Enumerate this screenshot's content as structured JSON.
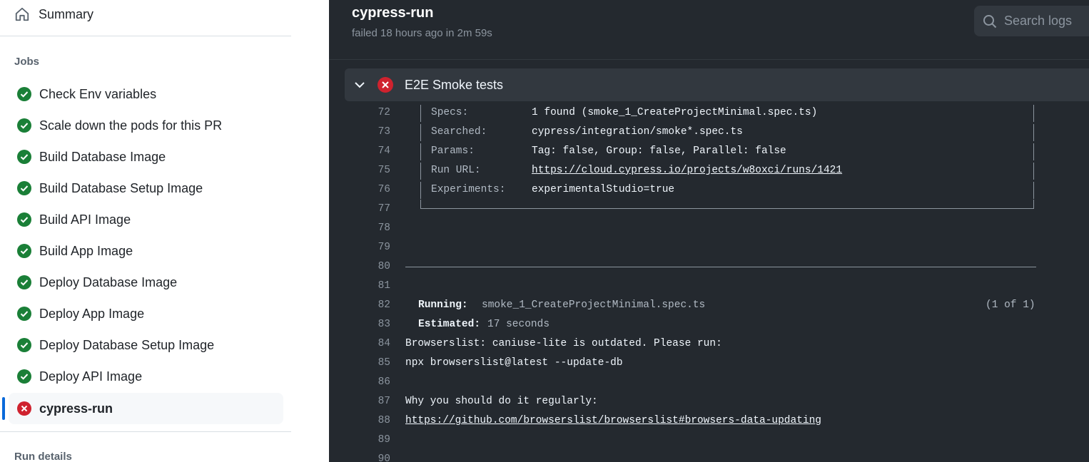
{
  "sidebar": {
    "summary_label": "Summary",
    "jobs_label": "Jobs",
    "run_details_label": "Run details",
    "jobs": [
      {
        "label": "Check Env variables",
        "status": "success"
      },
      {
        "label": "Scale down the pods for this PR",
        "status": "success"
      },
      {
        "label": "Build Database Image",
        "status": "success"
      },
      {
        "label": "Build Database Setup Image",
        "status": "success"
      },
      {
        "label": "Build API Image",
        "status": "success"
      },
      {
        "label": "Build App Image",
        "status": "success"
      },
      {
        "label": "Deploy Database Image",
        "status": "success"
      },
      {
        "label": "Deploy App Image",
        "status": "success"
      },
      {
        "label": "Deploy Database Setup Image",
        "status": "success"
      },
      {
        "label": "Deploy API Image",
        "status": "success"
      },
      {
        "label": "cypress-run",
        "status": "failure",
        "active": true
      }
    ]
  },
  "main": {
    "title": "cypress-run",
    "subtitle": "failed 18 hours ago in 2m 59s",
    "search_placeholder": "Search logs",
    "step": {
      "label": "E2E Smoke tests",
      "status": "failure"
    },
    "log": {
      "l72": {
        "n": "72",
        "key": "Specs:",
        "val": "1 found (smoke_1_CreateProjectMinimal.spec.ts)"
      },
      "l73": {
        "n": "73",
        "key": "Searched:",
        "val": "cypress/integration/smoke*.spec.ts"
      },
      "l74": {
        "n": "74",
        "key": "Params:",
        "val": "Tag: false, Group: false, Parallel: false"
      },
      "l75": {
        "n": "75",
        "key": "Run URL:",
        "val": "https://cloud.cypress.io/projects/w8oxci/runs/1421"
      },
      "l76": {
        "n": "76",
        "key": "Experiments:",
        "val": "experimentalStudio=true"
      },
      "l77": {
        "n": "77"
      },
      "l78": {
        "n": "78"
      },
      "l79": {
        "n": "79"
      },
      "l80": {
        "n": "80"
      },
      "l81": {
        "n": "81"
      },
      "l82": {
        "n": "82",
        "key": "Running:",
        "val": "smoke_1_CreateProjectMinimal.spec.ts",
        "right": "(1 of 1)"
      },
      "l83": {
        "n": "83",
        "key": "Estimated:",
        "val": "17 seconds"
      },
      "l84": {
        "n": "84",
        "text": "Browserslist: caniuse-lite is outdated. Please run:"
      },
      "l85": {
        "n": "85",
        "text": "npx browserslist@latest --update-db"
      },
      "l86": {
        "n": "86"
      },
      "l87": {
        "n": "87",
        "text": "Why you should do it regularly:"
      },
      "l88": {
        "n": "88",
        "text": "https://github.com/browserslist/browserslist#browsers-data-updating"
      },
      "l89": {
        "n": "89"
      },
      "l90": {
        "n": "90"
      }
    }
  },
  "colors": {
    "success": "#1a7f37",
    "failure": "#cf222e",
    "accent": "#0969da"
  }
}
